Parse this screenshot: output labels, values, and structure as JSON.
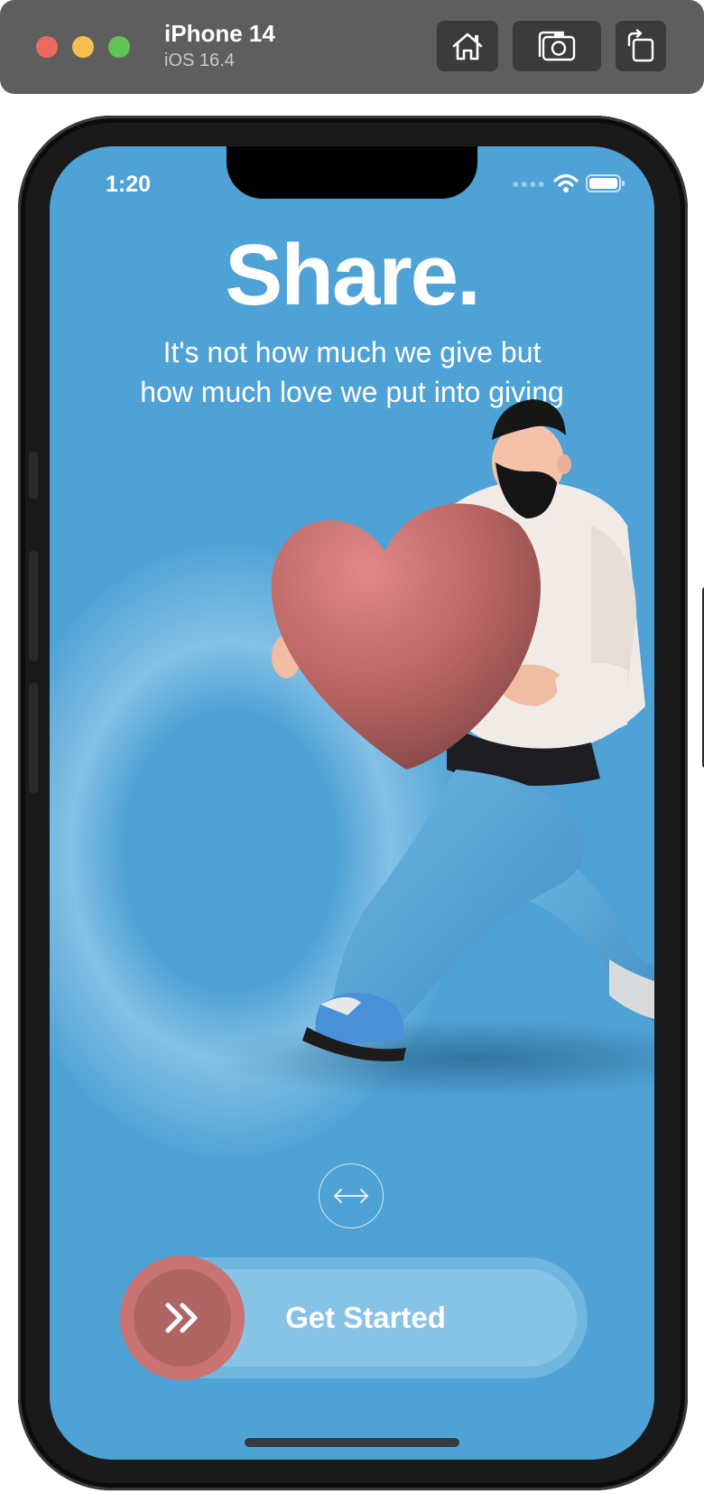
{
  "simulator": {
    "device_name": "iPhone 14",
    "os_version": "iOS 16.4",
    "buttons": [
      "home-icon",
      "screenshot-icon",
      "rotate-icon"
    ]
  },
  "status_bar": {
    "time": "1:20",
    "icons": [
      "signal-dots-icon",
      "wifi-icon",
      "battery-icon"
    ]
  },
  "onboarding": {
    "title": "Share.",
    "subtitle_line1": "It's not how much we give but",
    "subtitle_line2": "how much love we put into giving",
    "hero_image": "person-carrying-heart-illustration",
    "swipe_hint_icon": "swipe-arrows-icon",
    "cta_label": "Get Started",
    "cta_knob_icon": "double-chevron-right-icon"
  },
  "colors": {
    "screen_background": "#4fa2d6",
    "knob": "#c97373",
    "knob_inner": "#b06565",
    "slider_track": "#86c3e4",
    "heart": "#c46a6a"
  }
}
